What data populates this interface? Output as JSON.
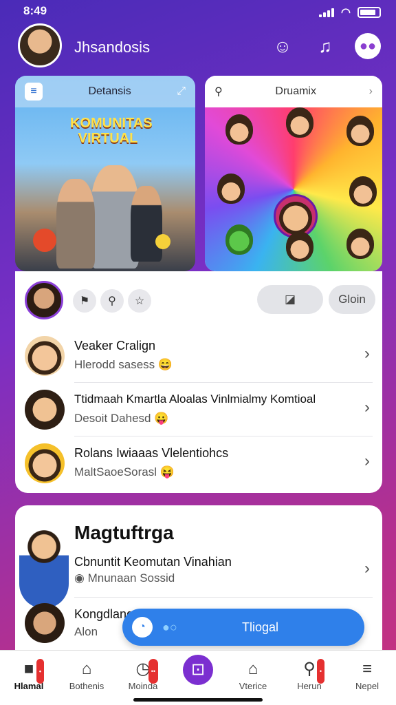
{
  "status": {
    "time": "8:49"
  },
  "header": {
    "username": "Jhsandosis"
  },
  "tile_left": {
    "title": "Detansis",
    "overlay": "KOMUNITAS VIRTUAL"
  },
  "tile_right": {
    "title": "Druamix"
  },
  "actions": {
    "pill1": "",
    "pill2": "Gloin"
  },
  "list": [
    {
      "name": "Veaker Cralign",
      "sub": "Hlerodd sasess",
      "emoji": "😄"
    },
    {
      "name": "Ttidmaah Kmartla Aloalas Vinlmialmy Komtioal",
      "sub": "Desoit Dahesd",
      "emoji": "😛"
    },
    {
      "name": "Rolans Iwiaaas Vlelentiohcs",
      "sub": "MaltSaoeSorasl",
      "emoji": "😝"
    }
  ],
  "section": {
    "title": "Magtuftrga",
    "row1_name": "Cbnuntit Keomutan Vinahian",
    "row1_sub": "Mnunaan Sossid",
    "row2_name": "Kongdlang",
    "row2_sub": "Alon"
  },
  "floating": {
    "label": "Tliogal"
  },
  "tabs": [
    {
      "label": "Hlamal"
    },
    {
      "label": "Bothenis"
    },
    {
      "label": "Moinda"
    },
    {
      "label": ""
    },
    {
      "label": "Vterice"
    },
    {
      "label": "Herun"
    },
    {
      "label": "Nepel"
    }
  ]
}
